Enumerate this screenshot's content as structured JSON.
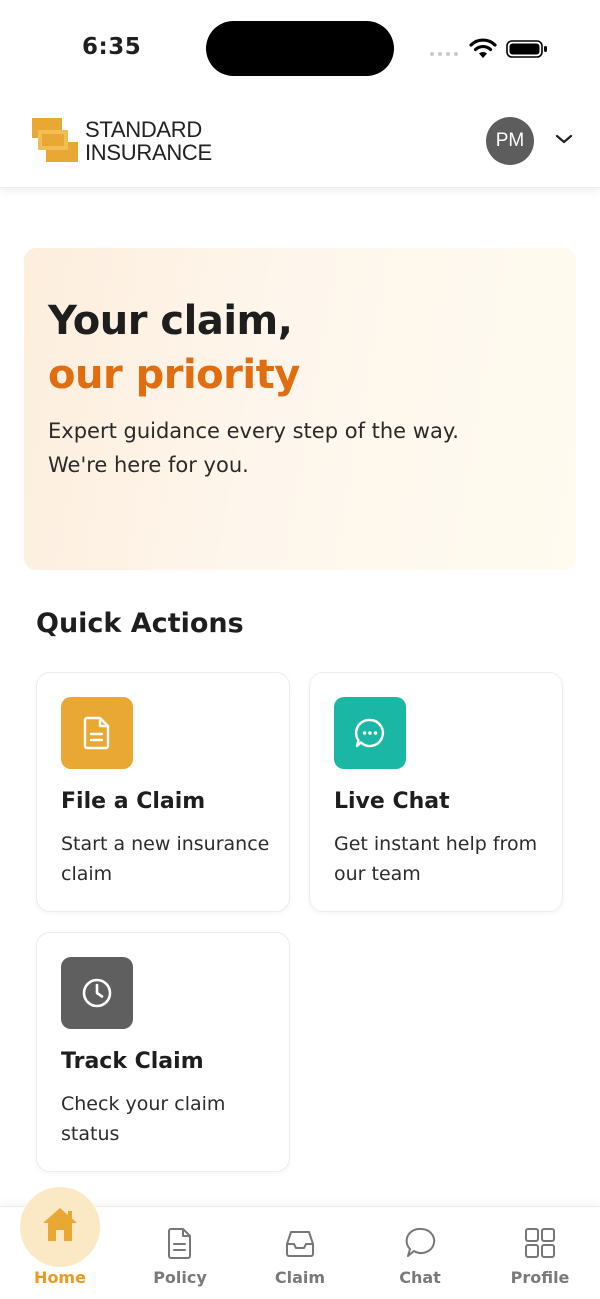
{
  "status_bar": {
    "time": "6:35"
  },
  "header": {
    "brand_line1": "STANDARD",
    "brand_line2": "INSURANCE",
    "avatar_initials": "PM"
  },
  "hero": {
    "title_line1": "Your claim,",
    "title_line2": "our priority",
    "subtitle_line1": "Expert guidance every step of the way.",
    "subtitle_line2": "We're here for you."
  },
  "quick_actions": {
    "title": "Quick Actions",
    "items": [
      {
        "title": "File a Claim",
        "desc": "Start a new insurance claim",
        "icon": "document-icon",
        "color": "#E8A833"
      },
      {
        "title": "Live Chat",
        "desc": "Get instant help from our team",
        "icon": "chat-bubble-icon",
        "color": "#1AB8A4"
      },
      {
        "title": "Track Claim",
        "desc": "Check your claim status",
        "icon": "clock-icon",
        "color": "#5F5F5F"
      }
    ]
  },
  "bottom_nav": {
    "active": "Home",
    "items": [
      {
        "label": "Home",
        "icon": "home-icon"
      },
      {
        "label": "Policy",
        "icon": "document-icon"
      },
      {
        "label": "Claim",
        "icon": "inbox-icon"
      },
      {
        "label": "Chat",
        "icon": "chat-icon"
      },
      {
        "label": "Profile",
        "icon": "grid-icon"
      }
    ]
  },
  "colors": {
    "brand_orange": "#E06D0F",
    "brand_gold": "#E8A833",
    "teal": "#1AB8A4",
    "gray": "#5F5F5F"
  }
}
